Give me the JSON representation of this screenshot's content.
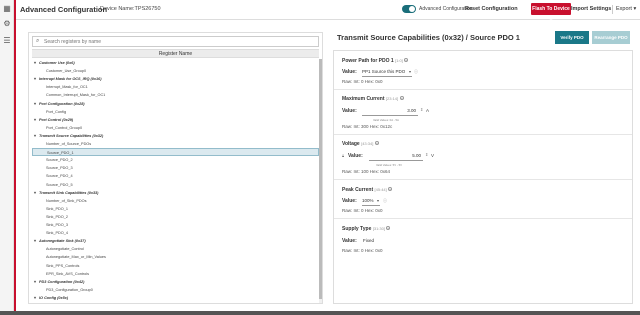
{
  "header": {
    "app_title": "Advanced Configuration",
    "device_name": "Device Name:TPS26750",
    "toggle_label": "Advanced Configuration",
    "reset_label": "Reset Configuration",
    "flash_label": "Flash To Device",
    "import_label": "Import Settings",
    "export_label": "Export"
  },
  "left": {
    "search_placeholder": "Search registers by name",
    "column_header": "Register Name",
    "tree": [
      {
        "label": "Customer Use (0x6)",
        "group": true
      },
      {
        "label": "Customer_Use_Group0",
        "group": false
      },
      {
        "label": "Interrupt Mask for OCS_IRQ (0x16)",
        "group": true
      },
      {
        "label": "Interrupt_Mask_for_OC1",
        "group": false
      },
      {
        "label": "Common_Interrupt_Mask_for_OC1",
        "group": false
      },
      {
        "label": "Port Configuration (0x28)",
        "group": true
      },
      {
        "label": "Port_Config",
        "group": false
      },
      {
        "label": "Port Control (0x29)",
        "group": true
      },
      {
        "label": "Port_Control_Group0",
        "group": false
      },
      {
        "label": "Transmit Source Capabilities (0x32)",
        "group": true
      },
      {
        "label": "Number_of_Source_PDOs",
        "group": false
      },
      {
        "label": "Source_PDO_1",
        "group": false,
        "selected": true
      },
      {
        "label": "Source_PDO_2",
        "group": false
      },
      {
        "label": "Source_PDO_3",
        "group": false
      },
      {
        "label": "Source_PDO_4",
        "group": false
      },
      {
        "label": "Source_PDO_5",
        "group": false
      },
      {
        "label": "Transmit Sink Capabilities (0x33)",
        "group": true
      },
      {
        "label": "Number_of_Sink_PDOs",
        "group": false
      },
      {
        "label": "Sink_PDO_1",
        "group": false
      },
      {
        "label": "Sink_PDO_2",
        "group": false
      },
      {
        "label": "Sink_PDO_3",
        "group": false
      },
      {
        "label": "Sink_PDO_4",
        "group": false
      },
      {
        "label": "Autonegotiate Sink (0x37)",
        "group": true
      },
      {
        "label": "Autonegotiate_Control",
        "group": false
      },
      {
        "label": "Autonegotiate_Max_or_Min_Values",
        "group": false
      },
      {
        "label": "Sink_PPS_Controls",
        "group": false
      },
      {
        "label": "EPR_Sink_AVS_Controls",
        "group": false
      },
      {
        "label": "PD3 Configuration (0x42)",
        "group": true
      },
      {
        "label": "PD3_Configuration_Group0",
        "group": false
      },
      {
        "label": "IO Config (0x5c)",
        "group": true
      }
    ]
  },
  "right": {
    "title": "Transmit Source Capabilities (0x32) / Source PDO 1",
    "verify_label": "Verify PDO",
    "rearrange_label": "Rearrange PDO",
    "power_path": {
      "title": "Power Path for PDO 1",
      "reg": "[1:0]",
      "value_label": "Value:",
      "value": "PP1 Source this PDO",
      "raw": "Raw: Int: 0 Hex: 0x0"
    },
    "max_current": {
      "title": "Maximum Current",
      "reg": "[23:14]",
      "value_label": "Value:",
      "value": "3.00",
      "unit": "A",
      "hint": "Valid Values: 0A - 5A",
      "raw": "Raw: Int: 300 Hex: 0x12c"
    },
    "voltage": {
      "title": "Voltage",
      "reg": "[43:34]",
      "value_label": "Value:",
      "value": "5.00",
      "unit": "V",
      "hint": "Valid Values: 5V - 5V",
      "raw": "Raw: Int: 100 Hex: 0x64"
    },
    "peak_current": {
      "title": "Peak Current",
      "reg": "[45:44]",
      "value_label": "Value:",
      "value": "100%",
      "raw": "Raw: Int: 0 Hex: 0x0"
    },
    "supply_type": {
      "title": "Supply Type",
      "reg": "[31:30]",
      "value_label": "Value:",
      "value": "Fixed",
      "raw": "Raw: Int: 0 Hex: 0x0"
    }
  },
  "colors": {
    "accent": "#1a7888",
    "brand_red": "#c8102e",
    "selection": "#dbe9ef"
  }
}
